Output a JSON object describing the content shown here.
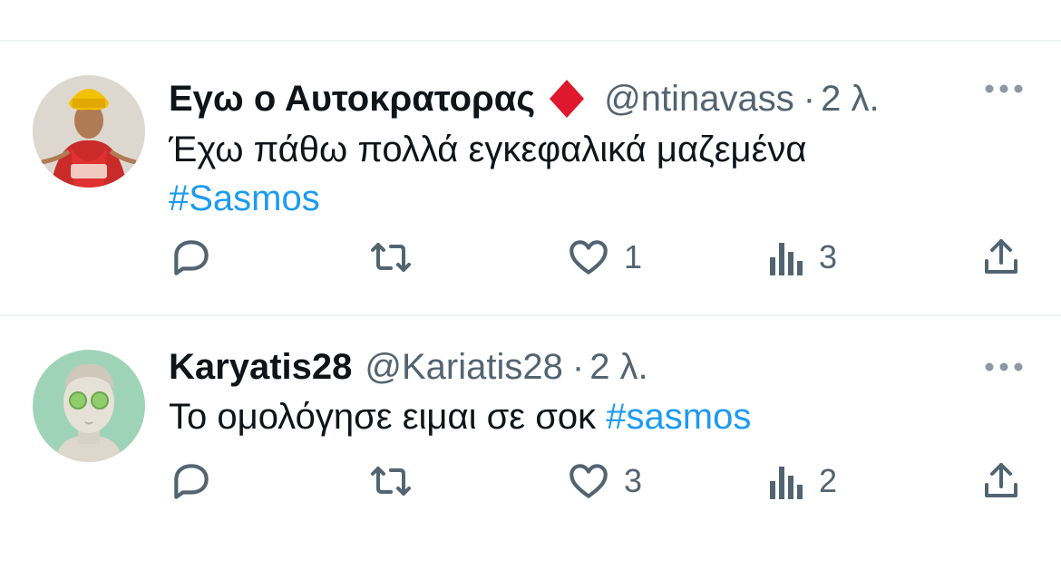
{
  "tweets": [
    {
      "name": "Εγω ο Αυτοκρατορας",
      "badge_icon": "red-diamond-emoji",
      "handle": "@ntinavass",
      "separator": "·",
      "time": "2 λ.",
      "text": "Έχω πάθω πολλά εγκεφαλικά μαζεμένα",
      "hashtag": "#Sasmos",
      "replies": "",
      "retweets": "",
      "likes": "1",
      "views": "3"
    },
    {
      "name": "Karyatis28",
      "handle": "@Kariatis28",
      "separator": "·",
      "time": "2 λ.",
      "text": "Το ομολόγησε ειμαι σε σοκ",
      "hashtag": "#sasmos",
      "replies": "",
      "retweets": "",
      "likes": "3",
      "views": "2"
    }
  ],
  "colors": {
    "text": "#0f1419",
    "secondary": "#536471",
    "link": "#1d9bf0",
    "divider": "#eff3f4",
    "badge": "#e0182d"
  },
  "icons": [
    "reply-icon",
    "retweet-icon",
    "like-icon",
    "views-icon",
    "share-icon",
    "more-icon"
  ]
}
